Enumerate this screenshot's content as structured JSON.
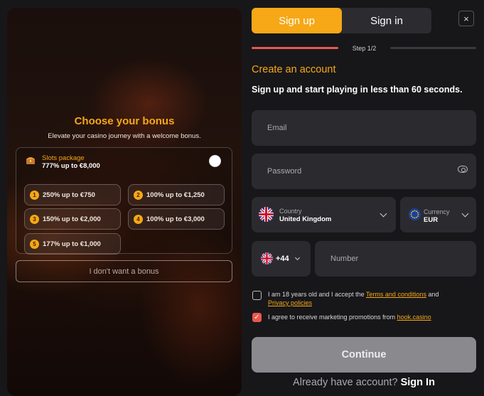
{
  "bonus": {
    "title": "Choose your bonus",
    "subtitle": "Elevate your casino journey with a welcome bonus.",
    "package": {
      "name": "Slots package",
      "value": "777% up to €8,000",
      "icon": "treasure-chest-icon"
    },
    "options": [
      {
        "num": "1",
        "label": "250% up to €750"
      },
      {
        "num": "2",
        "label": "100% up to €1,250"
      },
      {
        "num": "3",
        "label": "150% up to €2,000"
      },
      {
        "num": "4",
        "label": "100% up to €3,000"
      },
      {
        "num": "5",
        "label": "177% up to €1,000"
      }
    ],
    "no_bonus_label": "I don't want a bonus"
  },
  "tabs": {
    "signup": "Sign up",
    "signin": "Sign in"
  },
  "close_icon": "×",
  "step": {
    "label": "Step 1/2",
    "progress": 0.5
  },
  "form": {
    "title": "Create an account",
    "subtitle": "Sign up and start playing in less than 60 seconds.",
    "email_placeholder": "Email",
    "password_placeholder": "Password",
    "country": {
      "label": "Country",
      "value": "United Kingdom"
    },
    "currency": {
      "label": "Currency",
      "value": "EUR"
    },
    "phone_code": "+44",
    "number_placeholder": "Number",
    "age_text_1": "I am 18 years old and I accept the ",
    "terms_link": "Terms and conditions",
    "age_text_2": " and",
    "privacy_link": "Privacy policies",
    "marketing_text": "I agree to receive marketing promotions from ",
    "marketing_link": "hook.casino",
    "marketing_checked": true,
    "age_checked": false,
    "continue_label": "Continue",
    "already_text": "Already have account?",
    "signin_link": "Sign In"
  },
  "colors": {
    "accent": "#f6a816",
    "danger": "#e9574d",
    "field_bg": "#2b2b2f",
    "button_disabled": "#8a8a8e"
  }
}
